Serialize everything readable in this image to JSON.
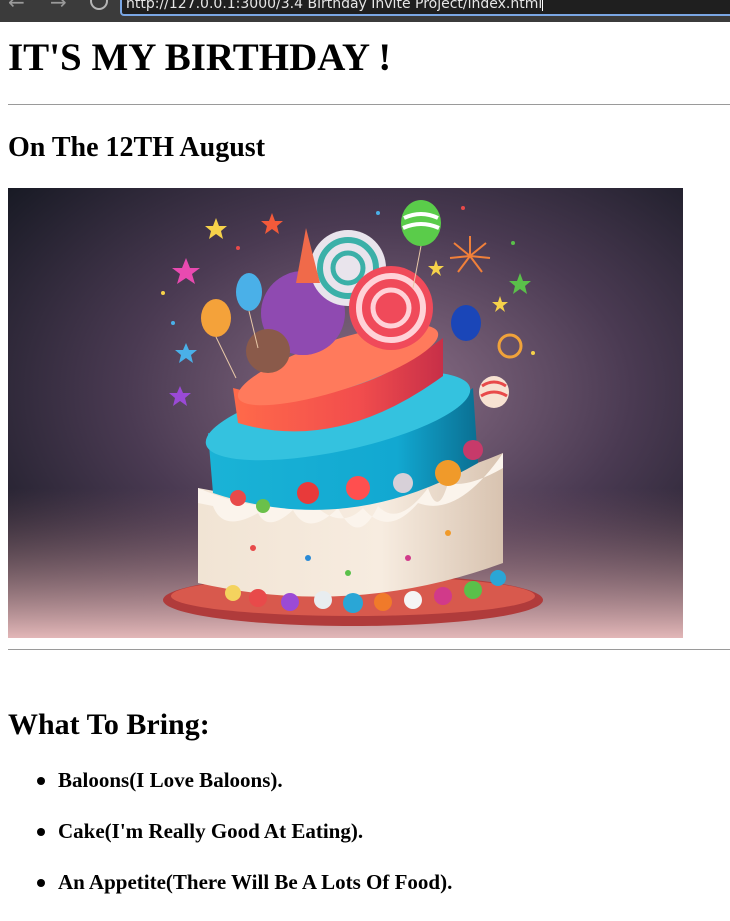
{
  "browser": {
    "url": "http://127.0.0.1:3000/3.4 Birthday Invite Project/index.html"
  },
  "page": {
    "title": "IT'S MY BIRTHDAY !",
    "date_heading": "On The 12TH August",
    "bring_heading": "What To Bring:",
    "bring_items": [
      "Baloons(I Love Baloons).",
      "Cake(I'm Really Good At Eating).",
      "An Appetite(There Will Be A Lots Of Food)."
    ]
  }
}
